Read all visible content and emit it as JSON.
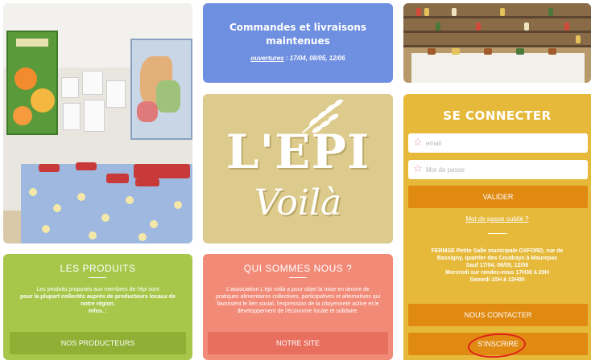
{
  "news": {
    "title": "Commandes et livraisons maintenues",
    "dates_label": "ouvertures",
    "dates_value": " : 17/04, 08/05, 12/06"
  },
  "logo": {
    "main": "L'EPI",
    "sub": "Voilà"
  },
  "login": {
    "title": "SE CONNECTER",
    "email_placeholder": "email",
    "password_placeholder": "Mot de passe",
    "validate_label": "VALIDER",
    "forgot_label": "Mot de passe oublié ?",
    "address_lines": [
      "FERMSE Petite Salle municipale OXFORD, rue de",
      "Bassigny, quartier des Coudrays à Maurepas",
      "Sauf 17/04, 08/05, 12/06",
      "Mercredi sur rendez-vous 17H30 à 20H",
      "Samedi 10H à 12H00"
    ],
    "contact_label": "NOUS CONTACTER",
    "register_label": "S'INSCRIRE"
  },
  "products": {
    "title": "LES PRODUITS",
    "text_intro": "Les produits proposés aux membres de l'épi sont",
    "text_bold": "pour la plupart collectés auprès de producteurs locaux de notre région.",
    "text_infos": "Infos. :",
    "button_label": "NOS PRODUCTEURS"
  },
  "about": {
    "title": "QUI SOMMES NOUS ?",
    "text": "L'association L'épi voilà a pour objet la mise en œuvre de pratiques alimentaires collectives, participatives et alternatives qui favorisent le lien social, l'expression de la citoyenneté active et le développement de l'économie locale et solidaire.",
    "button_label": "NOTRE SITE"
  },
  "colors": {
    "news_bg": "#6f8fe0",
    "logo_bg": "#dccb8c",
    "login_bg": "#e6b93b",
    "login_button": "#e08a12",
    "products_bg": "#a7c74a",
    "about_bg": "#f28a78",
    "highlight_circle": "#e0211a"
  },
  "icons": {
    "field_marker": "star-icon",
    "logo_mark": "wheat-icon"
  }
}
